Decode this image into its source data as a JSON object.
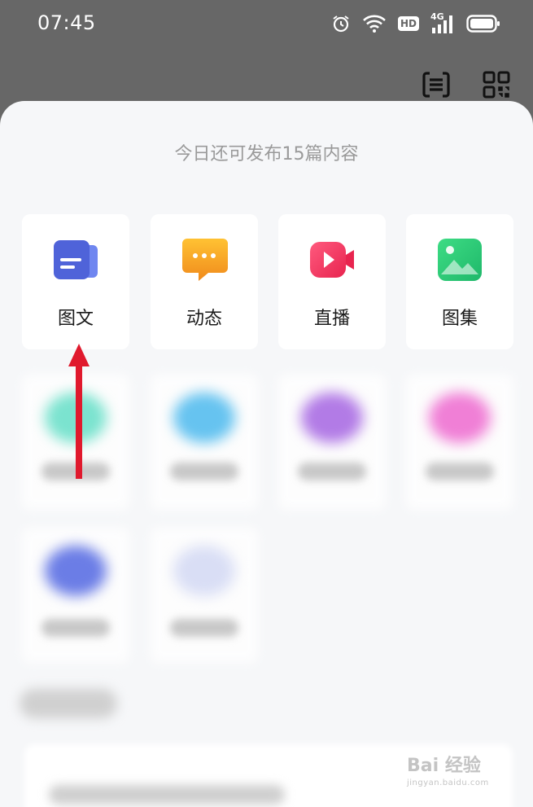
{
  "status_bar": {
    "time": "07:45",
    "icons": [
      "alarm-icon",
      "wifi-icon",
      "hd-icon",
      "signal-4g-icon",
      "battery-icon"
    ],
    "hd_label": "HD",
    "network_label": "4G"
  },
  "header": {
    "buttons": [
      "scan-icon",
      "qr-code-icon"
    ]
  },
  "sheet": {
    "subtitle": "今日还可发布15篇内容",
    "options": [
      {
        "label": "图文",
        "icon": "article-icon",
        "color": "#5b6ee8"
      },
      {
        "label": "动态",
        "icon": "chat-bubble-icon",
        "color": "#f5a623"
      },
      {
        "label": "直播",
        "icon": "video-camera-icon",
        "color": "#f2436d"
      },
      {
        "label": "图集",
        "icon": "image-gallery-icon",
        "color": "#2ecc71"
      }
    ]
  },
  "watermark": {
    "main": "Bai 经验",
    "sub": "jingyan.baidu.com"
  },
  "colors": {
    "overlay": "#676767",
    "sheet_bg": "#f6f7f9",
    "arrow": "#e0192d"
  }
}
